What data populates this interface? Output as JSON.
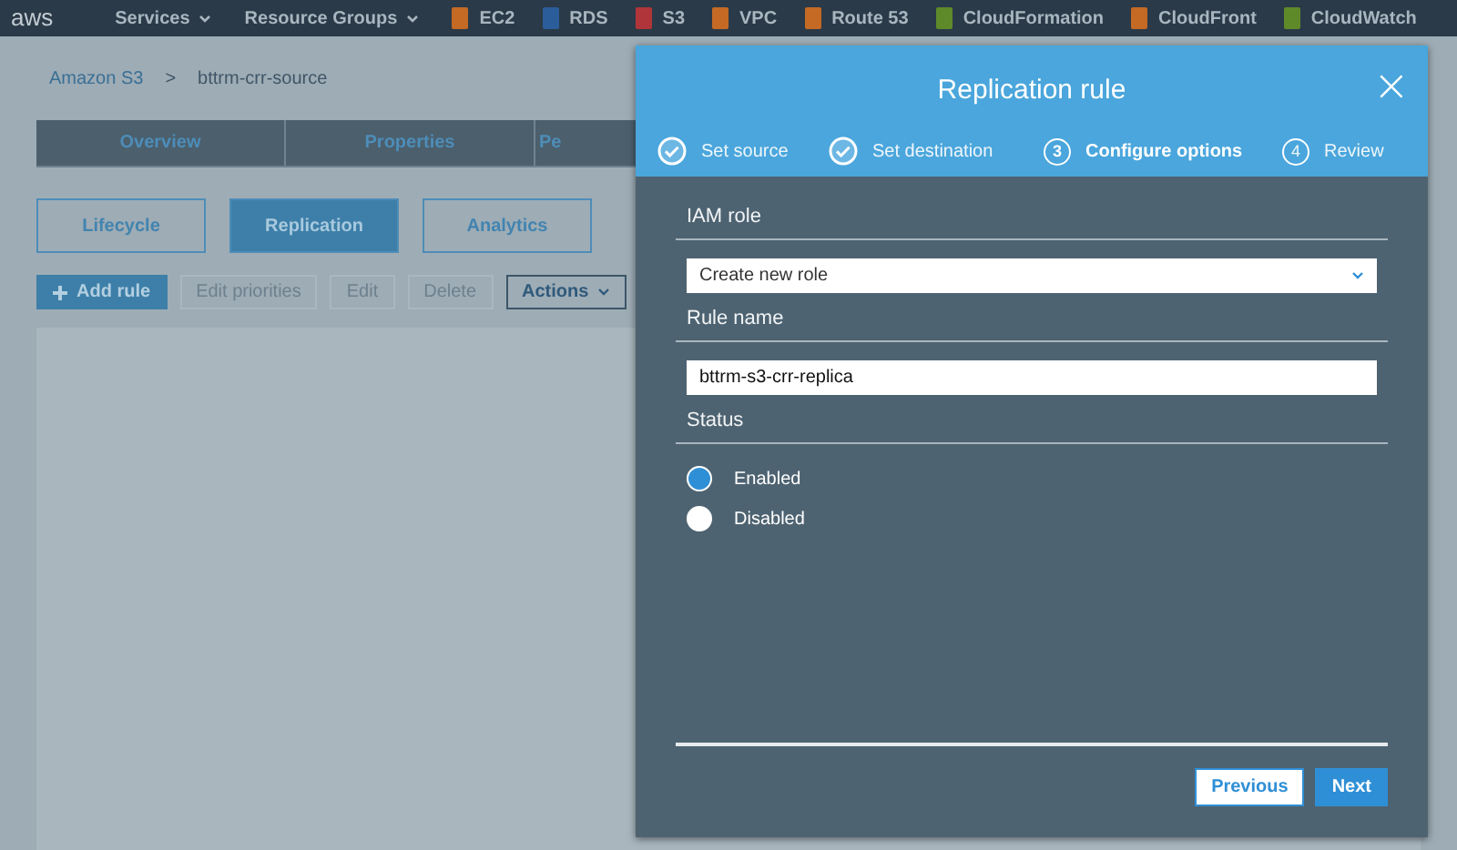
{
  "topbar": {
    "logo": "aws",
    "menus": [
      {
        "label": "Services"
      },
      {
        "label": "Resource Groups"
      }
    ],
    "services": [
      {
        "label": "EC2",
        "color": "#c46a24"
      },
      {
        "label": "RDS",
        "color": "#2b5d9a"
      },
      {
        "label": "S3",
        "color": "#b0353a"
      },
      {
        "label": "VPC",
        "color": "#c46a24"
      },
      {
        "label": "Route 53",
        "color": "#c46a24"
      },
      {
        "label": "CloudFormation",
        "color": "#5f8a2a"
      },
      {
        "label": "CloudFront",
        "color": "#c46a24"
      },
      {
        "label": "CloudWatch",
        "color": "#5f8a2a"
      }
    ]
  },
  "breadcrumb": [
    {
      "label": "Amazon S3",
      "link": true
    },
    {
      "label": "bttrm-crr-source",
      "link": false
    }
  ],
  "breadcrumb_separator": ">",
  "tabs": [
    {
      "label": "Overview",
      "selected": false
    },
    {
      "label": "Properties",
      "selected": false
    },
    {
      "label": "Pe",
      "selected": false
    }
  ],
  "subtabs": [
    {
      "label": "Lifecycle",
      "selected": false
    },
    {
      "label": "Replication",
      "selected": true
    },
    {
      "label": "Analytics",
      "selected": false
    }
  ],
  "actions": [
    {
      "label": "Add rule",
      "kind": "primary",
      "disabled": false
    },
    {
      "label": "Edit priorities",
      "kind": "plain",
      "disabled": true
    },
    {
      "label": "Edit",
      "kind": "plain",
      "disabled": true
    },
    {
      "label": "Delete",
      "kind": "plain",
      "disabled": true
    },
    {
      "label": "Actions",
      "kind": "menu",
      "disabled": false
    }
  ],
  "modal": {
    "title": "Replication rule",
    "close": "×",
    "steps": [
      {
        "label": "Set source",
        "done": true,
        "selected": false
      },
      {
        "label": "Set destination",
        "done": true,
        "selected": false
      },
      {
        "number": "3",
        "label": "Configure options",
        "done": false,
        "selected": true
      },
      {
        "number": "4",
        "label": "Review",
        "done": false,
        "selected": false
      }
    ],
    "iam_role": {
      "label": "IAM role",
      "value": "Create new role"
    },
    "rule_name": {
      "label": "Rule name",
      "value": "bttrm-s3-crr-replica"
    },
    "status": {
      "label": "Status",
      "options": [
        {
          "label": "Enabled",
          "selected": true
        },
        {
          "label": "Disabled",
          "selected": false
        }
      ]
    },
    "buttons": [
      {
        "label": "Previous",
        "kind": "secondary"
      },
      {
        "label": "Next",
        "kind": "primary"
      }
    ]
  }
}
